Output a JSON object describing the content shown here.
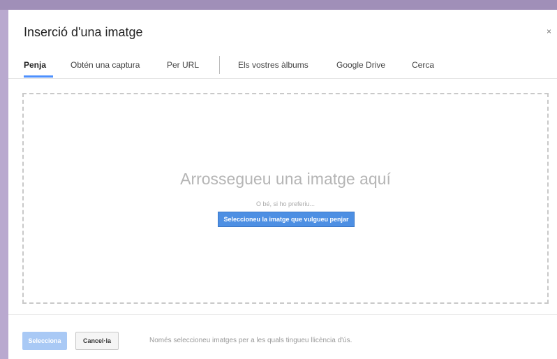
{
  "dialog": {
    "title": "Inserció d'una imatge",
    "close_label": "×"
  },
  "tabs": [
    {
      "label": "Penja",
      "active": true
    },
    {
      "label": "Obtén una captura",
      "active": false
    },
    {
      "label": "Per URL",
      "active": false
    },
    {
      "label": "Els vostres àlbums",
      "active": false
    },
    {
      "label": "Google Drive",
      "active": false
    },
    {
      "label": "Cerca",
      "active": false
    }
  ],
  "dropzone": {
    "title": "Arrossegueu una imatge aquí",
    "or_text": "O bé, si ho preferiu...",
    "select_button": "Seleccioneu la imatge que vulgueu penjar"
  },
  "footer": {
    "select_button": "Selecciona",
    "cancel_button": "Cancel·la",
    "note": "Només seleccioneu imatges per a les quals tingueu llicència d'ús."
  },
  "colors": {
    "accent": "#4d90fe",
    "select_disabled": "#a9c9f5"
  }
}
